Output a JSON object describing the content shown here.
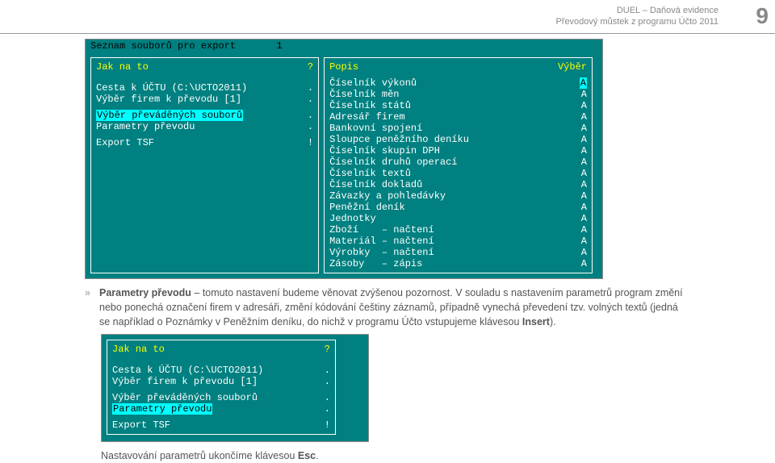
{
  "header": {
    "line1": "DUEL – Daňová evidence",
    "line2": "Převodový můstek z programu Účto 2011",
    "page": "9"
  },
  "shot1": {
    "title_left": "Seznam souborů pro export",
    "title_right": "1",
    "left": {
      "hdr_l": "Jak na to",
      "hdr_r": "?",
      "r1_l": "Cesta k ÚČTU (C:\\UCTO2011)",
      "r1_r": ".",
      "r2_l": "Výběr firem k převodu [1]",
      "r2_r": ".",
      "r3_l": "Výběr převáděných souborů",
      "r3_r": ".",
      "r4_l": "Parametry převodu",
      "r4_r": ".",
      "r5_l": "Export TSF",
      "r5_r": "!"
    },
    "right": {
      "hdr_l": "Popis",
      "hdr_r": "Výběr",
      "rows": [
        {
          "l": "Číselník výkonů",
          "r": "A"
        },
        {
          "l": "Číselník měn",
          "r": "A"
        },
        {
          "l": "Číselník států",
          "r": "A"
        },
        {
          "l": "Adresář firem",
          "r": "A"
        },
        {
          "l": "Bankovní spojení",
          "r": "A"
        },
        {
          "l": "Sloupce peněžního deníku",
          "r": "A"
        },
        {
          "l": "Číselník skupin DPH",
          "r": "A"
        },
        {
          "l": "Číselník druhů operací",
          "r": "A"
        },
        {
          "l": "Číselník textů",
          "r": "A"
        },
        {
          "l": "Číselník dokladů",
          "r": "A"
        },
        {
          "l": "Závazky a pohledávky",
          "r": "A"
        },
        {
          "l": "Peněžní deník",
          "r": "A"
        },
        {
          "l": "Jednotky",
          "r": "A"
        },
        {
          "l": "Zboží    – načtení",
          "r": "A"
        },
        {
          "l": "Materiál – načtení",
          "r": "A"
        },
        {
          "l": "Výrobky  – načtení",
          "r": "A"
        },
        {
          "l": "Zásoby   – zápis",
          "r": "A"
        }
      ]
    }
  },
  "para": {
    "lead": "Parametry převodu",
    "text1": " – tomuto nastavení budeme věnovat zvýšenou pozornost. V souladu s nastavením parametrů program změní nebo ponechá označení firem v adresáři, změní kódování češtiny záznamů, případně vynechá převedení tzv. volných textů (jedná se například o Poznámky v Peněžním deníku, do nichž v programu Účto vstupujeme klávesou ",
    "ins": "Insert",
    "tail": ")."
  },
  "shot2": {
    "hdr_l": "Jak na to",
    "hdr_r": "?",
    "r1_l": "Cesta k ÚČTU (C:\\UCTO2011)",
    "r1_r": ".",
    "r2_l": "Výběr firem k převodu [1]",
    "r2_r": ".",
    "r3_l": "Výběr převáděných souborů",
    "r3_r": ".",
    "r4_l": "Parametry převodu",
    "r4_r": ".",
    "r5_l": "Export TSF",
    "r5_r": "!"
  },
  "closing": {
    "t1": "Nastavování parametrů ukončíme klávesou ",
    "esc": "Esc",
    "t2": "."
  }
}
